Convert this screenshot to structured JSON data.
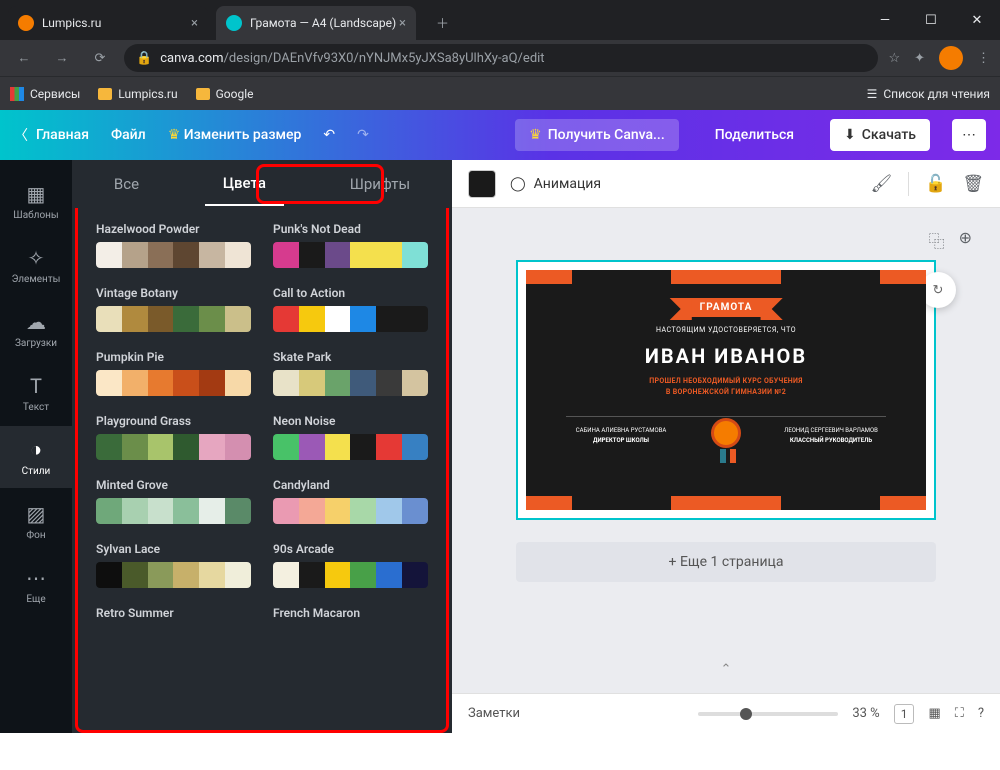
{
  "browser": {
    "tabs": [
      {
        "label": "Lumpics.ru",
        "favcolor": "#f57c00"
      },
      {
        "label": "Грамота — A4 (Landscape)",
        "favcolor": "#00c4cc"
      }
    ],
    "url_host": "canva.com",
    "url_path": "/design/DAEnVfv93X0/nYNJMx5yJXSa8yUlhXy-aQ/edit",
    "bookmarks": [
      "Сервисы",
      "Lumpics.ru",
      "Google"
    ],
    "reading_list": "Список для чтения"
  },
  "canva_menu": {
    "home": "Главная",
    "file": "Файл",
    "resize": "Изменить размер",
    "get_pro": "Получить Canva...",
    "share": "Поделиться",
    "download": "Скачать"
  },
  "rail": [
    {
      "id": "templates",
      "label": "Шаблоны",
      "icon": "▦"
    },
    {
      "id": "elements",
      "label": "Элементы",
      "icon": "✧"
    },
    {
      "id": "uploads",
      "label": "Загрузки",
      "icon": "☁"
    },
    {
      "id": "text",
      "label": "Текст",
      "icon": "T"
    },
    {
      "id": "styles",
      "label": "Стили",
      "icon": "◑",
      "active": true
    },
    {
      "id": "bg",
      "label": "Фон",
      "icon": "▨"
    },
    {
      "id": "more",
      "label": "Еще",
      "icon": "⋯"
    }
  ],
  "panel_tabs": {
    "all": "Все",
    "colors": "Цвета",
    "fonts": "Шрифты"
  },
  "palettes": [
    {
      "name": "Hazelwood Powder",
      "c": [
        "#f3eee7",
        "#b5a28a",
        "#8a6f57",
        "#5e4631",
        "#c7b6a1",
        "#efe4d5"
      ]
    },
    {
      "name": "Punk's Not Dead",
      "c": [
        "#d63b8e",
        "#1a1a1a",
        "#6b4a8a",
        "#f4e04d",
        "#f4e04d",
        "#7fe0d6"
      ]
    },
    {
      "name": "Vintage Botany",
      "c": [
        "#e9dfba",
        "#b08a3e",
        "#7a5a2a",
        "#3a6b3a",
        "#6b8e4a",
        "#cbbf8a"
      ]
    },
    {
      "name": "Call to Action",
      "c": [
        "#e53935",
        "#f6c90e",
        "#ffffff",
        "#1e88e5",
        "#1a1a1a",
        "#1a1a1a"
      ]
    },
    {
      "name": "Pumpkin Pie",
      "c": [
        "#fbe7c6",
        "#f2b06a",
        "#e77a2f",
        "#c94f1a",
        "#a33a12",
        "#f7d9a8"
      ]
    },
    {
      "name": "Skate Park",
      "c": [
        "#e8e2c8",
        "#d7c97a",
        "#6aa36a",
        "#3f5a7a",
        "#3a3a3a",
        "#d4c4a0"
      ]
    },
    {
      "name": "Playground Grass",
      "c": [
        "#3a6b3a",
        "#6b8e4a",
        "#a8c46b",
        "#2f5a2f",
        "#e6a6c0",
        "#d48fb0"
      ]
    },
    {
      "name": "Neon Noise",
      "c": [
        "#48c268",
        "#9b59b6",
        "#f4e04d",
        "#1a1a1a",
        "#e53935",
        "#3780c2"
      ]
    },
    {
      "name": "Minted Grove",
      "c": [
        "#6fa87a",
        "#a8d0b0",
        "#c8e0cc",
        "#8abf9a",
        "#e6eee8",
        "#5a8a68"
      ]
    },
    {
      "name": "Candyland",
      "c": [
        "#ea9ab2",
        "#f4a896",
        "#f6d06a",
        "#a8d8a8",
        "#a0c8ea",
        "#6a8fd0"
      ]
    },
    {
      "name": "Sylvan Lace",
      "c": [
        "#0e0e0e",
        "#4a5a2a",
        "#8a9a5a",
        "#c7b06a",
        "#e6d8a0",
        "#f0eeda"
      ]
    },
    {
      "name": "90s Arcade",
      "c": [
        "#f4f0e0",
        "#1a1a1a",
        "#f6c90e",
        "#48a048",
        "#2a6ed0",
        "#14143a"
      ]
    },
    {
      "name": "Retro Summer",
      "c": []
    },
    {
      "name": "French Macaron",
      "c": []
    }
  ],
  "toolbar": {
    "animation": "Анимация"
  },
  "certificate": {
    "title": "ГРАМОТА",
    "subtitle": "НАСТОЯЩИМ УДОСТОВЕРЯЕТСЯ, ЧТО",
    "name": "ИВАН ИВАНОВ",
    "line1": "ПРОШЕЛ НЕОБХОДИМЫЙ КУРС ОБУЧЕНИЯ",
    "line2": "В ВОРОНЕЖСКОЙ ГИМНАЗИИ №2",
    "sig_left_name": "САБИНА АЛИЕВНА РУСТАМОВА",
    "sig_left_role": "ДИРЕКТОР ШКОЛЫ",
    "sig_right_name": "ЛЕОНИД СЕРГЕЕВИЧ ВАРЛАМОВ",
    "sig_right_role": "КЛАССНЫЙ РУКОВОДИТЕЛЬ"
  },
  "add_page": "+ Еще 1 страница",
  "bottom": {
    "notes": "Заметки",
    "zoom": "33 %",
    "page": "1"
  }
}
